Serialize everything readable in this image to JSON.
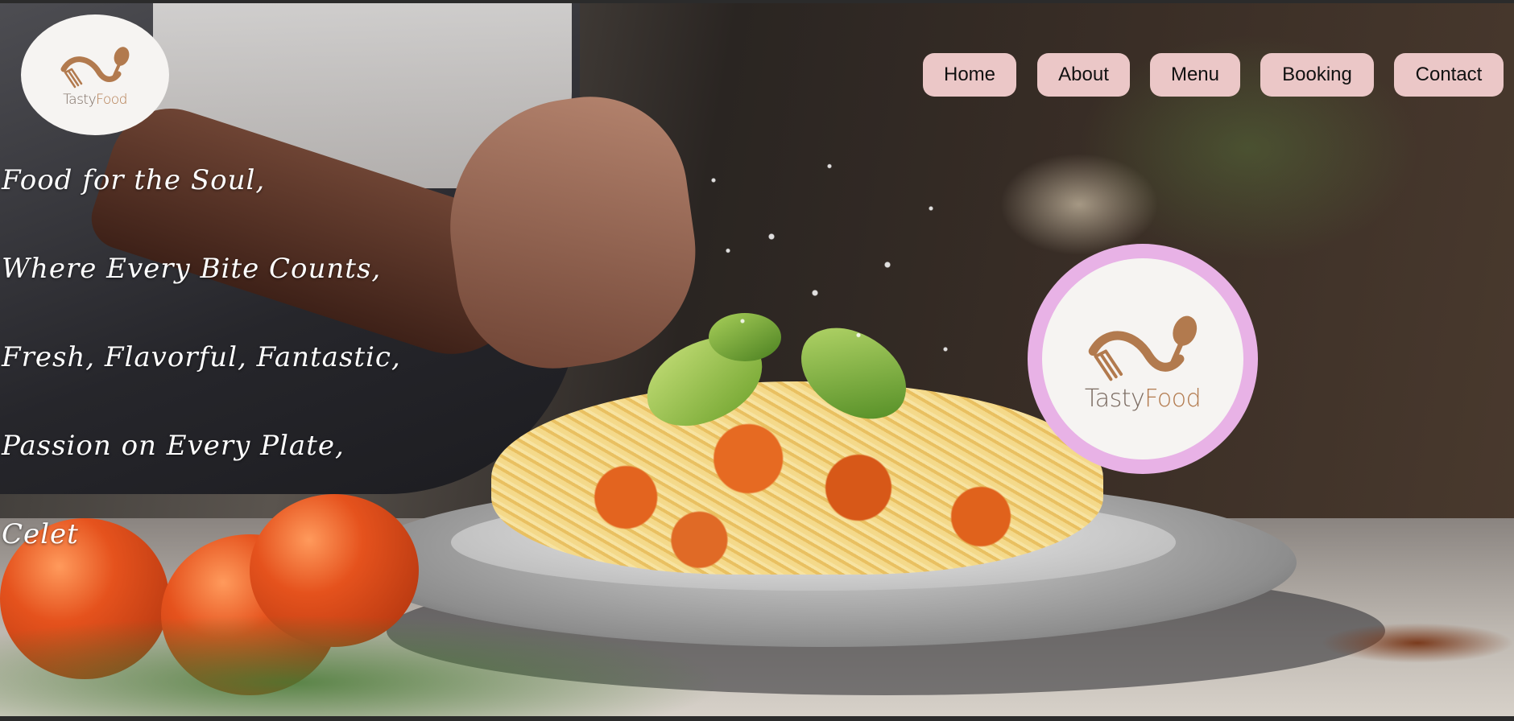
{
  "brand": {
    "name_part1": "Tasty",
    "name_part2": "Food",
    "colors": {
      "logo_brown": "#b27a4e",
      "logo_grey": "#7a6a60",
      "nav_bg": "#ebc7c7",
      "big_logo_ring": "#e8b2e6"
    },
    "icons": [
      "fork-spoon-logo-icon"
    ]
  },
  "nav": {
    "items": [
      {
        "label": "Home"
      },
      {
        "label": "About"
      },
      {
        "label": "Menu"
      },
      {
        "label": "Booking"
      },
      {
        "label": "Contact"
      }
    ]
  },
  "hero": {
    "slogans": [
      "Food for the Soul,",
      "Where Every Bite Counts,",
      "Fresh, Flavorful, Fantastic,",
      "Passion on Every Plate,",
      "Celet"
    ]
  }
}
